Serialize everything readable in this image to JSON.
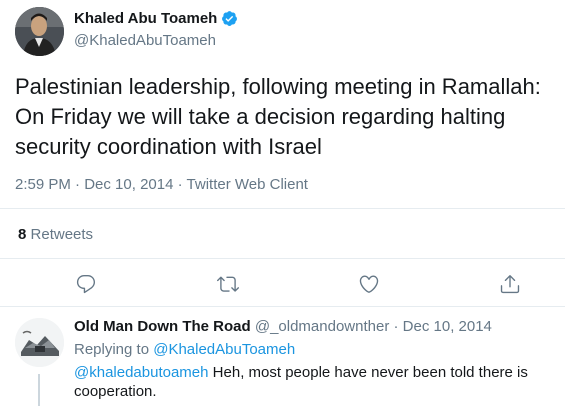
{
  "author": {
    "name": "Khaled Abu Toameh",
    "handle": "@KhaledAbuToameh",
    "verified_icon": "verified-badge-icon"
  },
  "tweet": {
    "text": "Palestinian leadership, following meeting in Ramallah: On Friday we will take a decision regarding halting security coordination with Israel",
    "time": "2:59 PM",
    "date": "Dec 10, 2014",
    "source": "Twitter Web Client"
  },
  "stats": {
    "retweet_count": "8",
    "retweet_label": "Retweets"
  },
  "actions": {
    "reply_icon": "reply-icon",
    "retweet_icon": "retweet-icon",
    "like_icon": "heart-icon",
    "share_icon": "share-icon"
  },
  "reply": {
    "name": "Old Man Down The Road",
    "handle": "@_oldmandownther",
    "date": "Dec 10, 2014",
    "replying_to_label": "Replying to",
    "replying_to_handle": "@KhaledAbuToameh",
    "mention": "@khaledabutoameh",
    "text": "Heh, most people have never been told there is cooperation."
  },
  "colors": {
    "accent": "#1b95e0",
    "secondary_text": "#657786",
    "icon_gray": "#657786",
    "separator": "#e6ecf0"
  }
}
